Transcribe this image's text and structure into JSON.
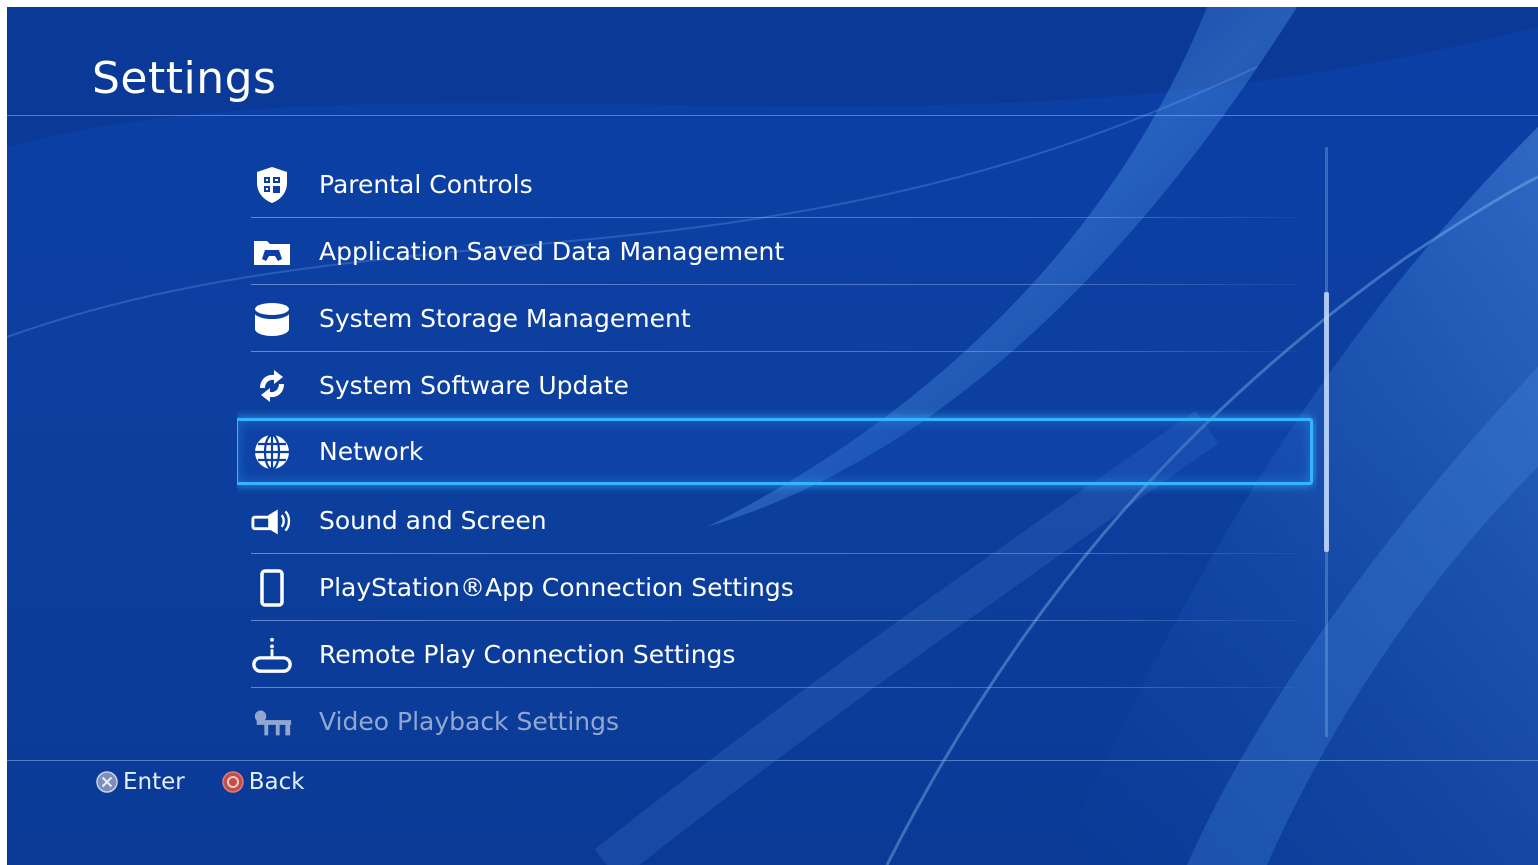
{
  "header": {
    "title": "Settings"
  },
  "menu": {
    "items": [
      {
        "label": "Parental Controls",
        "icon": "parental-controls-shield-icon",
        "state": "normal"
      },
      {
        "label": "Application Saved Data Management",
        "icon": "saved-data-folder-icon",
        "state": "normal"
      },
      {
        "label": "System Storage Management",
        "icon": "storage-cylinder-icon",
        "state": "normal"
      },
      {
        "label": "System Software Update",
        "icon": "update-arrows-icon",
        "state": "normal"
      },
      {
        "label": "Network",
        "icon": "globe-icon",
        "state": "selected"
      },
      {
        "label": "Sound and Screen",
        "icon": "sound-screen-icon",
        "state": "normal"
      },
      {
        "label": "PlayStation®App Connection Settings",
        "icon": "smartphone-icon",
        "state": "normal"
      },
      {
        "label": "Remote Play Connection Settings",
        "icon": "remote-play-icon",
        "state": "normal"
      },
      {
        "label": "Video Playback Settings",
        "icon": "video-playback-icon",
        "state": "faded"
      }
    ]
  },
  "footer": {
    "enter_label": "Enter",
    "back_label": "Back",
    "enter_icon": "cross-button-icon",
    "back_icon": "circle-button-icon"
  },
  "colors": {
    "background": "#0b3fa6",
    "selection_border": "#35b4ff",
    "text": "#ffffff"
  }
}
